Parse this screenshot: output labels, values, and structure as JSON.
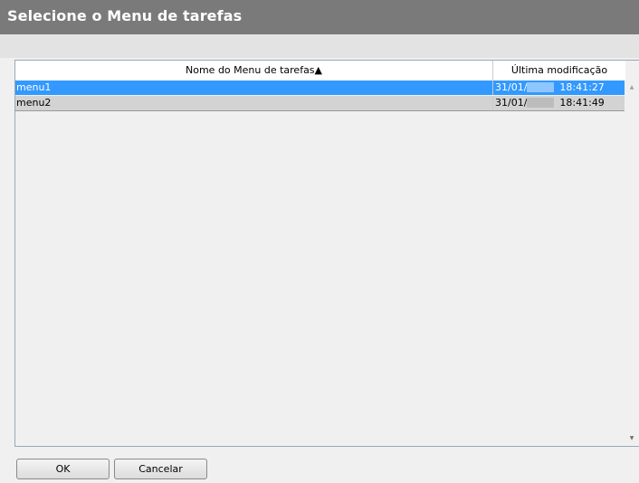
{
  "dialog": {
    "title": "Selecione o Menu de tarefas"
  },
  "table": {
    "columns": [
      "Nome do Menu de tarefas▲",
      "Última modificação"
    ],
    "rows": [
      {
        "name": "menu1",
        "date_prefix": "31/01/",
        "time": "18:41:27",
        "selected": true
      },
      {
        "name": "menu2",
        "date_prefix": "31/01/",
        "time": "18:41:49",
        "selected": false
      }
    ]
  },
  "scroll": {
    "up_icon": "scroll-up-arrow",
    "down_icon": "scroll-down-arrow"
  },
  "buttons": {
    "ok": "OK",
    "cancel": "Cancelar"
  }
}
